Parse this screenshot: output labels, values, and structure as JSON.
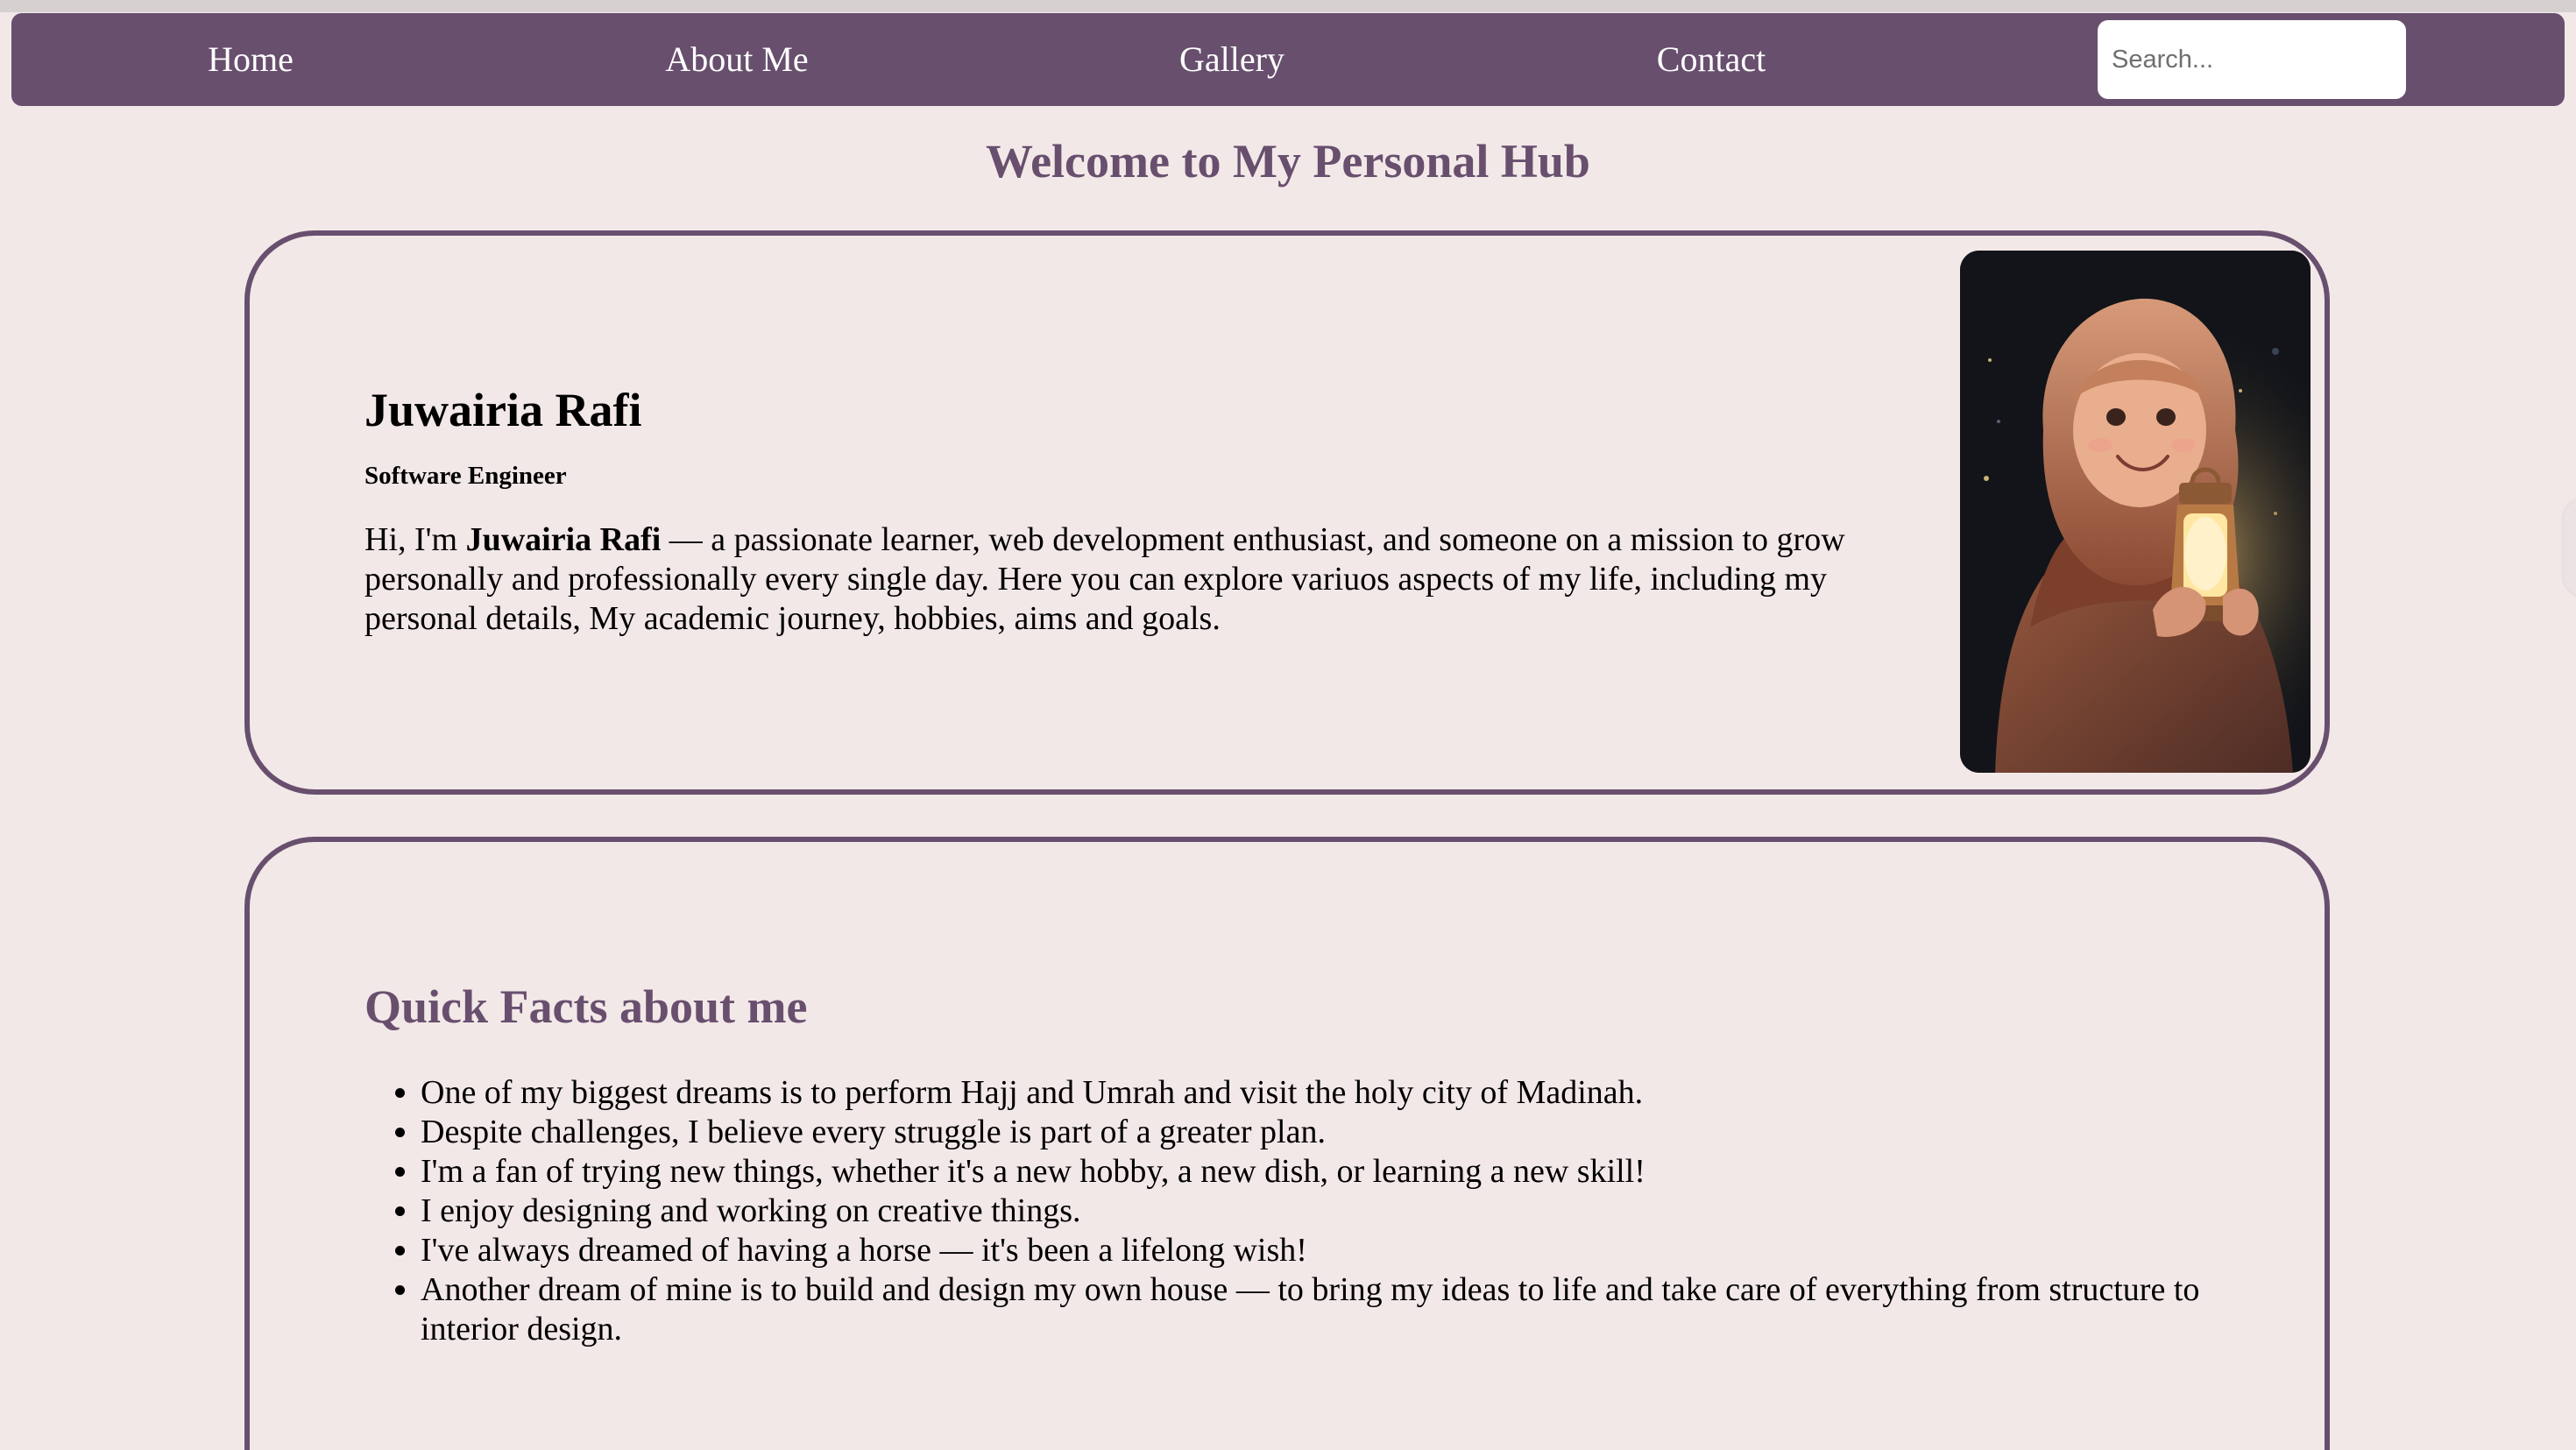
{
  "nav": {
    "items": [
      {
        "label": "Home"
      },
      {
        "label": "About Me"
      },
      {
        "label": "Gallery"
      },
      {
        "label": "Contact"
      }
    ],
    "search_placeholder": "Search..."
  },
  "page": {
    "title": "Welcome to My Personal Hub"
  },
  "intro": {
    "name": "Juwairia Rafi",
    "role": "Software Engineer",
    "paragraph_prefix": "Hi, I'm ",
    "paragraph_name": "Juwairia Rafi",
    "paragraph_rest": " — a passionate learner, web development enthusiast, and someone on a mission to grow personally and professionally every single day. Here you can explore variuos aspects of my life, including my personal details, My academic journey, hobbies, aims and goals."
  },
  "facts": {
    "heading": "Quick Facts about me",
    "items": [
      "One of my biggest dreams is to perform Hajj and Umrah and visit the holy city of Madinah.",
      "Despite challenges, I believe every struggle is part of a greater plan.",
      "I'm a fan of trying new things, whether it's a new hobby, a new dish, or learning a new skill!",
      "I enjoy designing and working on creative things.",
      "I've always dreamed of having a horse — it's been a lifelong wish!",
      "Another dream of mine is to build and design my own house — to bring my ideas to life and take care of everything from structure to interior design."
    ]
  },
  "colors": {
    "accent": "#684f6e",
    "background": "#f3e8e8"
  }
}
